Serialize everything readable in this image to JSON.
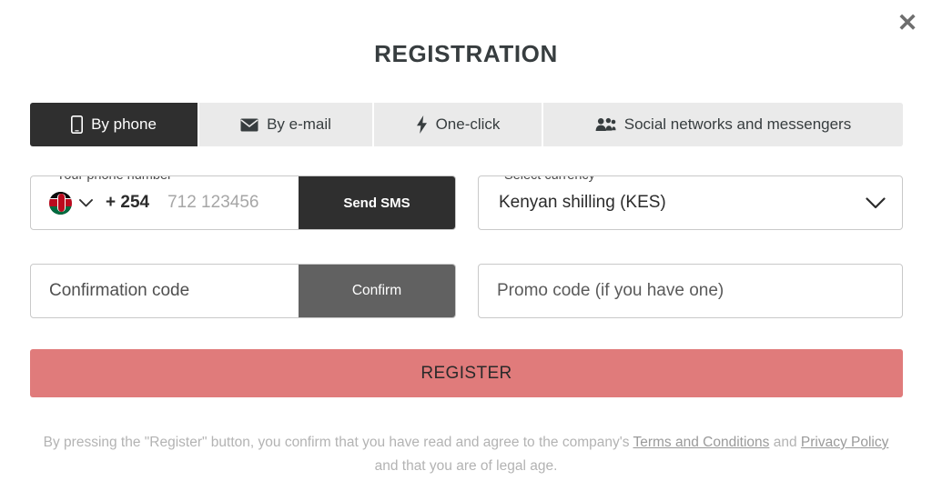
{
  "window": {
    "title": "REGISTRATION",
    "close_label": "✕"
  },
  "tabs": [
    {
      "label": "By phone",
      "icon": "mobile-phone-icon",
      "active": true
    },
    {
      "label": "By e-mail",
      "icon": "envelope-icon",
      "active": false
    },
    {
      "label": "One-click",
      "icon": "lightning-bolt-icon",
      "active": false
    },
    {
      "label": "Social networks and messengers",
      "icon": "users-group-icon",
      "active": false
    }
  ],
  "phone_field": {
    "label": "Your phone number",
    "country_flag": "kenya-flag-icon",
    "country_code": "+ 254",
    "placeholder": "712 123456",
    "value": "",
    "button_label": "Send SMS"
  },
  "currency_field": {
    "label": "Select currency",
    "value": "Kenyan shilling (KES)",
    "options": [
      "Kenyan shilling (KES)"
    ]
  },
  "confirmation_field": {
    "placeholder": "Confirmation code",
    "value": "",
    "button_label": "Confirm"
  },
  "promo_field": {
    "placeholder": "Promo code (if you have one)",
    "value": ""
  },
  "register": {
    "label": "REGISTER",
    "color": "#e07b7b"
  },
  "footer": {
    "text_part1": "By pressing the \"Register\" button, you confirm that you have read and agree to the company's ",
    "terms_link": "Terms and Conditions",
    "text_part2": " and ",
    "privacy_link": "Privacy Policy",
    "text_part3": " and that you are of legal age."
  },
  "colors": {
    "active_tab_bg": "#2f2f2f",
    "inactive_tab_bg": "#eaeaea",
    "send_sms_bg": "#2f2f2f",
    "confirm_bg": "#616161",
    "register_bg": "#e07b7b",
    "title_text": "#373d3f"
  }
}
